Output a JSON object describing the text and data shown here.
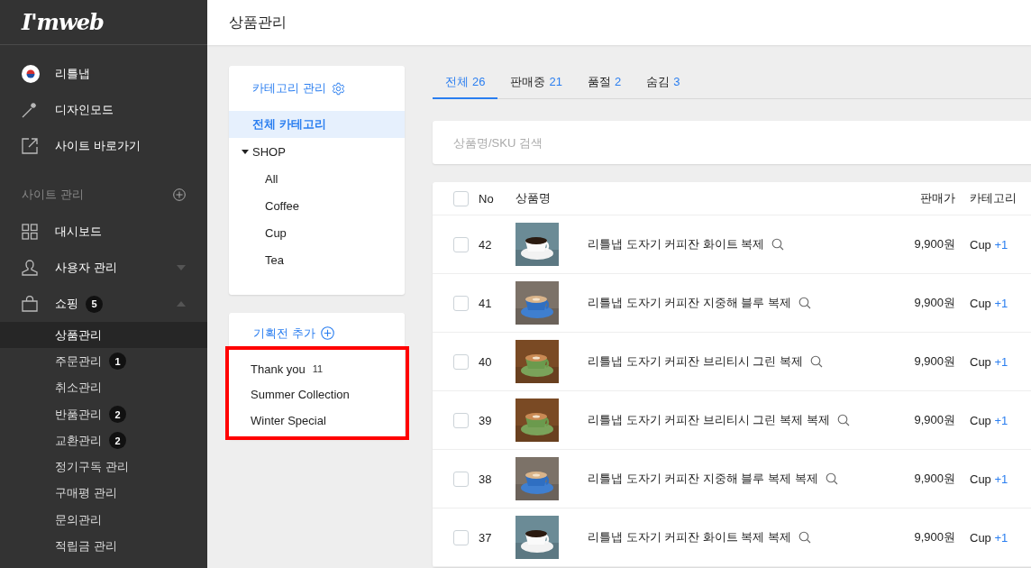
{
  "sidebar": {
    "logo": "I'mweb",
    "top_links": [
      {
        "label": "리틀냅",
        "kind": "flag"
      },
      {
        "label": "디자인모드",
        "kind": "wand"
      },
      {
        "label": "사이트 바로가기",
        "kind": "external"
      }
    ],
    "section_title": "사이트 관리",
    "menu": [
      {
        "label": "대시보드",
        "kind": "grid"
      },
      {
        "label": "사용자 관리",
        "kind": "user",
        "expanded": false
      },
      {
        "label": "쇼핑",
        "kind": "bag",
        "badge": "5",
        "expanded": true,
        "children": [
          {
            "label": "상품관리",
            "selected": true
          },
          {
            "label": "주문관리",
            "badge": "1",
            "selected": false
          },
          {
            "label": "취소관리",
            "selected": false
          },
          {
            "label": "반품관리",
            "badge": "2",
            "selected": false
          },
          {
            "label": "교환관리",
            "badge": "2",
            "selected": false
          },
          {
            "label": "정기구독 관리",
            "selected": false
          },
          {
            "label": "구매평 관리",
            "selected": false
          },
          {
            "label": "문의관리",
            "selected": false
          },
          {
            "label": "적립금 관리",
            "selected": false
          }
        ]
      }
    ]
  },
  "header": {
    "title": "상품관리"
  },
  "category_panel": {
    "title": "카테고리 관리",
    "items": [
      {
        "label": "전체 카테고리",
        "selected": true
      },
      {
        "label": "SHOP",
        "selected": false,
        "expanded": true,
        "children": [
          {
            "label": "All",
            "selected": false
          },
          {
            "label": "Coffee",
            "selected": false
          },
          {
            "label": "Cup",
            "selected": false
          },
          {
            "label": "Tea",
            "selected": false
          }
        ]
      }
    ]
  },
  "exhibition_panel": {
    "title": "기획전 추가",
    "highlighted": true,
    "items": [
      {
        "label": "Thank you",
        "count": "11"
      },
      {
        "label": "Summer Collection"
      },
      {
        "label": "Winter Special"
      }
    ]
  },
  "tabs": [
    {
      "label": "전체",
      "count": "26",
      "selected": true
    },
    {
      "label": "판매중",
      "count": "21",
      "selected": false
    },
    {
      "label": "품절",
      "count": "2",
      "selected": false
    },
    {
      "label": "숨김",
      "count": "3",
      "selected": false
    }
  ],
  "search": {
    "placeholder": "상품명/SKU 검색"
  },
  "table": {
    "columns": [
      "No",
      "상품명",
      "판매가",
      "카테고리"
    ],
    "all_checked": false,
    "rows": [
      {
        "no": "42",
        "name": "리틀냅 도자기 커피잔 화이트 복제",
        "price": "9,900원",
        "category": "Cup",
        "extra": "+1",
        "checked": false
      },
      {
        "no": "41",
        "name": "리틀냅 도자기 커피잔 지중해 블루 복제",
        "price": "9,900원",
        "category": "Cup",
        "extra": "+1",
        "checked": false
      },
      {
        "no": "40",
        "name": "리틀냅 도자기 커피잔 브리티시 그린 복제",
        "price": "9,900원",
        "category": "Cup",
        "extra": "+1",
        "checked": false
      },
      {
        "no": "39",
        "name": "리틀냅 도자기 커피잔 브리티시 그린 복제 복제",
        "price": "9,900원",
        "category": "Cup",
        "extra": "+1",
        "checked": false
      },
      {
        "no": "38",
        "name": "리틀냅 도자기 커피잔 지중해 블루 복제 복제",
        "price": "9,900원",
        "category": "Cup",
        "extra": "+1",
        "checked": false
      },
      {
        "no": "37",
        "name": "리틀냅 도자기 커피잔 화이트 복제 복제",
        "price": "9,900원",
        "category": "Cup",
        "extra": "+1",
        "checked": false
      }
    ]
  }
}
